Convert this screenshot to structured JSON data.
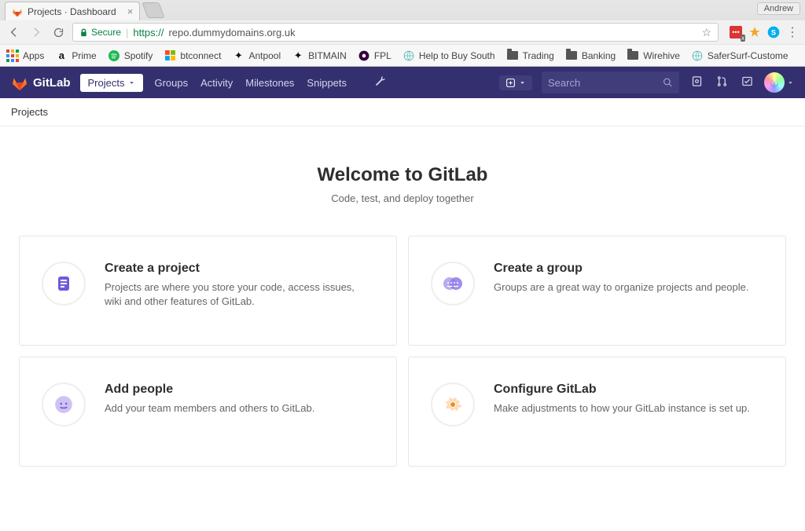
{
  "browser": {
    "tab_title": "Projects · Dashboard",
    "user_chip": "Andrew",
    "secure_label": "Secure",
    "url_scheme": "https://",
    "url_host_path": "repo.dummydomains.org.uk"
  },
  "bookmarks": [
    {
      "label": "Apps",
      "icon": "apps"
    },
    {
      "label": "Prime",
      "icon": "amazon"
    },
    {
      "label": "Spotify",
      "icon": "spotify"
    },
    {
      "label": "btconnect",
      "icon": "ms"
    },
    {
      "label": "Antpool",
      "icon": "ant"
    },
    {
      "label": "BITMAIN",
      "icon": "ant"
    },
    {
      "label": "FPL",
      "icon": "fpl"
    },
    {
      "label": "Help to Buy South",
      "icon": "htb"
    },
    {
      "label": "Trading",
      "icon": "folder"
    },
    {
      "label": "Banking",
      "icon": "folder"
    },
    {
      "label": "Wirehive",
      "icon": "folder"
    },
    {
      "label": "SaferSurf-Custome",
      "icon": "globe"
    }
  ],
  "nav": {
    "brand": "GitLab",
    "projects": "Projects",
    "links": [
      "Groups",
      "Activity",
      "Milestones",
      "Snippets"
    ],
    "search_placeholder": "Search"
  },
  "page": {
    "breadcrumb": "Projects",
    "title": "Welcome to GitLab",
    "subtitle": "Code, test, and deploy together"
  },
  "cards": [
    {
      "title": "Create a project",
      "desc": "Projects are where you store your code, access issues, wiki and other features of GitLab."
    },
    {
      "title": "Create a group",
      "desc": "Groups are a great way to organize projects and people."
    },
    {
      "title": "Add people",
      "desc": "Add your team members and others to GitLab."
    },
    {
      "title": "Configure GitLab",
      "desc": "Make adjustments to how your GitLab instance is set up."
    }
  ]
}
